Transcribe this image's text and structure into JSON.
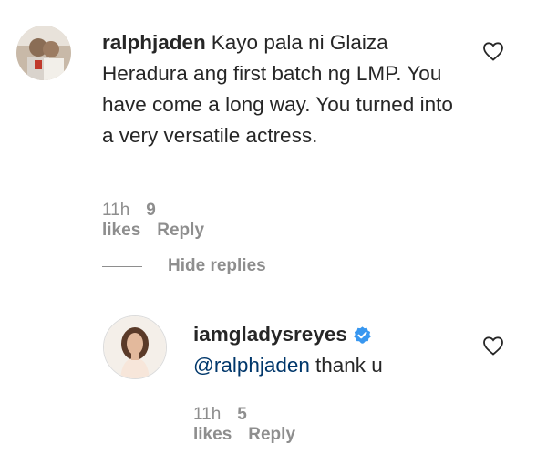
{
  "comments": [
    {
      "username": "ralphjaden",
      "text": "Kayo pala ni Glaiza Heradura ang first batch ng LMP. You have come a long way. You turned into a very versatile actress.",
      "time": "11h",
      "likes": "9 likes",
      "reply_label": "Reply"
    }
  ],
  "hide_replies_label": "Hide replies",
  "reply": {
    "username": "iamgladysreyes",
    "mention": "@ralphjaden",
    "text": "thank u",
    "time": "11h",
    "likes": "5 likes",
    "reply_label": "Reply"
  },
  "icons": {
    "like": "heart-outline-icon",
    "verified": "verified-badge-icon"
  },
  "colors": {
    "text": "#262626",
    "secondary": "#8e8e8e",
    "mention": "#00376b",
    "verified": "#3897f0"
  }
}
